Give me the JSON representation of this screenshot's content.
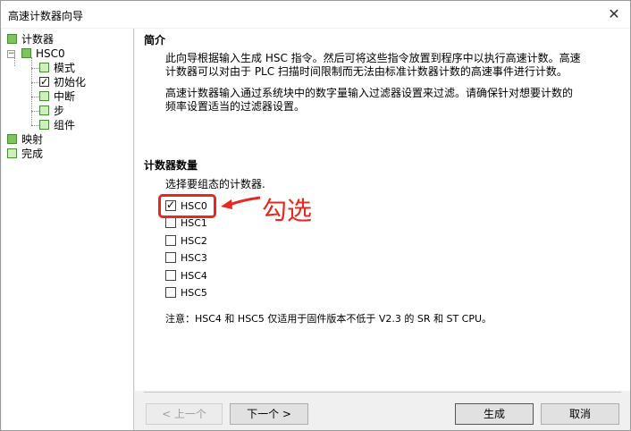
{
  "window": {
    "title": "高速计数器向导",
    "close_glyph": "✕"
  },
  "tree": {
    "items": [
      {
        "label": "计数器"
      },
      {
        "label": "HSC0"
      },
      {
        "label": "模式"
      },
      {
        "label": "初始化"
      },
      {
        "label": "中断"
      },
      {
        "label": "步"
      },
      {
        "label": "组件"
      },
      {
        "label": "映射"
      },
      {
        "label": "完成"
      }
    ],
    "expander_glyph": "−"
  },
  "intro": {
    "title": "简介",
    "para1_line1": "此向导根据输入生成 HSC 指令。然后可将这些指令放置到程序中以执行高速计数。高速",
    "para1_line2": "计数器可以对由于 PLC 扫描时间限制而无法由标准计数器计数的高速事件进行计数。",
    "para2_line1": "高速计数器输入通过系统块中的数字量输入过滤器设置来过滤。请确保针对想要计数的",
    "para2_line2": "频率设置适当的过滤器设置。"
  },
  "counters": {
    "title": "计数器数量",
    "prompt": "选择要组态的计数器.",
    "options": [
      {
        "label": "HSC0",
        "checked": true
      },
      {
        "label": "HSC1",
        "checked": false
      },
      {
        "label": "HSC2",
        "checked": false
      },
      {
        "label": "HSC3",
        "checked": false
      },
      {
        "label": "HSC4",
        "checked": false
      },
      {
        "label": "HSC5",
        "checked": false
      }
    ],
    "note": "注意：HSC4 和 HSC5 仅适用于固件版本不低于 V2.3 的 SR 和 ST CPU。"
  },
  "annotation": {
    "text": "勾选",
    "color": "#e8281e"
  },
  "buttons": {
    "prev": "< 上一个",
    "next": "下一个 >",
    "finish": "生成",
    "cancel": "取消"
  }
}
